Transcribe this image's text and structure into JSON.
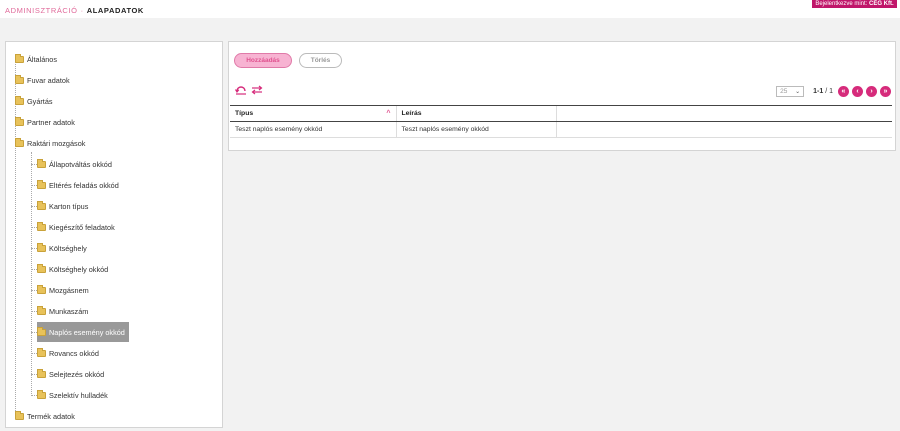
{
  "header": {
    "breadcrumb": [
      "ADMINISZTRÁCIÓ",
      "ALAPADATOK"
    ],
    "breadcrumb_sep": "·",
    "login_prefix": "Bejelentkezve mint: ",
    "login_user": "CÉG Kft."
  },
  "tree": {
    "top_items": [
      "Általános",
      "Fuvar adatok",
      "Gyártás",
      "Partner adatok",
      "Raktári mozgások"
    ],
    "children": [
      "Állapotváltás okkód",
      "Eltérés feladás okkód",
      "Karton típus",
      "Kiegészítő feladatok",
      "Költséghely",
      "Költséghely okkód",
      "Mozgásnem",
      "Munkaszám",
      "Naplós esemény okkód",
      "Rovancs okkód",
      "Selejtezés okkód",
      "Szelektív hulladék"
    ],
    "last_item": "Termék adatok",
    "selected": "Naplós esemény okkód"
  },
  "toolbar": {
    "add_label": "Hozzáadás",
    "delete_label": "Törlés",
    "refresh_icon": "refresh-icon",
    "swap_icon": "swap-icon"
  },
  "pager": {
    "page_size": "25",
    "range": "1-1",
    "total": "/ 1",
    "first": "«",
    "prev": "‹",
    "next": "›",
    "last": "»"
  },
  "table": {
    "headers": [
      "Típus",
      "Leírás"
    ],
    "sort_indicator": "^",
    "rows": [
      [
        "Teszt naplós esemény okkód",
        "Teszt naplós esemény okkód"
      ]
    ]
  },
  "colors": {
    "accent": "#d62b7b",
    "add_button_bg": "#f7b3d2",
    "login_bg": "#c0166a",
    "selected_bg": "#999999"
  }
}
